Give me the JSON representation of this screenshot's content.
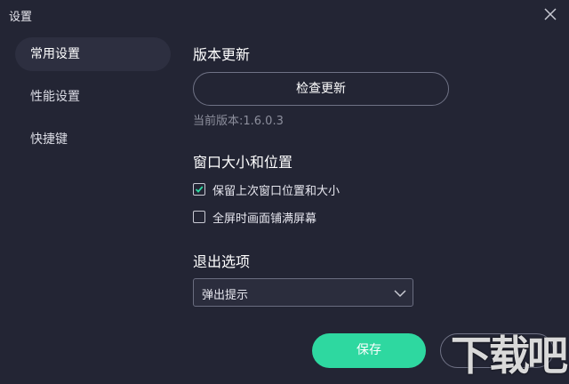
{
  "window": {
    "title": "设置"
  },
  "sidebar": {
    "items": [
      {
        "label": "常用设置",
        "active": true
      },
      {
        "label": "性能设置",
        "active": false
      },
      {
        "label": "快捷键",
        "active": false
      }
    ]
  },
  "sections": {
    "update": {
      "title": "版本更新",
      "check_button": "检查更新",
      "current_version": "当前版本:1.6.0.3"
    },
    "window_size": {
      "title": "窗口大小和位置",
      "options": [
        {
          "label": "保留上次窗口位置和大小",
          "checked": true
        },
        {
          "label": "全屏时画面铺满屏幕",
          "checked": false
        }
      ]
    },
    "exit": {
      "title": "退出选项",
      "selected": "弹出提示"
    }
  },
  "footer": {
    "save_label": "保存"
  },
  "watermark": {
    "text": "下载吧"
  },
  "colors": {
    "background": "#232534",
    "accent": "#2ed8a0",
    "active_item": "#2d2f40"
  }
}
